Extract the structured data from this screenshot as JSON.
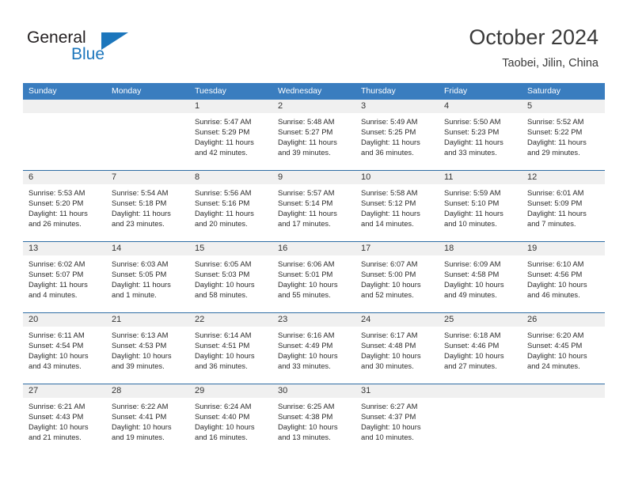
{
  "brand": {
    "name_part1": "General",
    "name_part2": "Blue",
    "accent_color": "#1c76bc"
  },
  "header": {
    "title": "October 2024",
    "location": "Taobei, Jilin, China"
  },
  "theme": {
    "header_bg": "#3a7dbf",
    "row_divider": "#2e6da4",
    "date_band_bg": "#f0f0f0"
  },
  "weekdays": [
    "Sunday",
    "Monday",
    "Tuesday",
    "Wednesday",
    "Thursday",
    "Friday",
    "Saturday"
  ],
  "weeks": [
    [
      {
        "date": "",
        "empty": true
      },
      {
        "date": "",
        "empty": true
      },
      {
        "date": "1",
        "sunrise": "Sunrise: 5:47 AM",
        "sunset": "Sunset: 5:29 PM",
        "daylight1": "Daylight: 11 hours",
        "daylight2": "and 42 minutes."
      },
      {
        "date": "2",
        "sunrise": "Sunrise: 5:48 AM",
        "sunset": "Sunset: 5:27 PM",
        "daylight1": "Daylight: 11 hours",
        "daylight2": "and 39 minutes."
      },
      {
        "date": "3",
        "sunrise": "Sunrise: 5:49 AM",
        "sunset": "Sunset: 5:25 PM",
        "daylight1": "Daylight: 11 hours",
        "daylight2": "and 36 minutes."
      },
      {
        "date": "4",
        "sunrise": "Sunrise: 5:50 AM",
        "sunset": "Sunset: 5:23 PM",
        "daylight1": "Daylight: 11 hours",
        "daylight2": "and 33 minutes."
      },
      {
        "date": "5",
        "sunrise": "Sunrise: 5:52 AM",
        "sunset": "Sunset: 5:22 PM",
        "daylight1": "Daylight: 11 hours",
        "daylight2": "and 29 minutes."
      }
    ],
    [
      {
        "date": "6",
        "sunrise": "Sunrise: 5:53 AM",
        "sunset": "Sunset: 5:20 PM",
        "daylight1": "Daylight: 11 hours",
        "daylight2": "and 26 minutes."
      },
      {
        "date": "7",
        "sunrise": "Sunrise: 5:54 AM",
        "sunset": "Sunset: 5:18 PM",
        "daylight1": "Daylight: 11 hours",
        "daylight2": "and 23 minutes."
      },
      {
        "date": "8",
        "sunrise": "Sunrise: 5:56 AM",
        "sunset": "Sunset: 5:16 PM",
        "daylight1": "Daylight: 11 hours",
        "daylight2": "and 20 minutes."
      },
      {
        "date": "9",
        "sunrise": "Sunrise: 5:57 AM",
        "sunset": "Sunset: 5:14 PM",
        "daylight1": "Daylight: 11 hours",
        "daylight2": "and 17 minutes."
      },
      {
        "date": "10",
        "sunrise": "Sunrise: 5:58 AM",
        "sunset": "Sunset: 5:12 PM",
        "daylight1": "Daylight: 11 hours",
        "daylight2": "and 14 minutes."
      },
      {
        "date": "11",
        "sunrise": "Sunrise: 5:59 AM",
        "sunset": "Sunset: 5:10 PM",
        "daylight1": "Daylight: 11 hours",
        "daylight2": "and 10 minutes."
      },
      {
        "date": "12",
        "sunrise": "Sunrise: 6:01 AM",
        "sunset": "Sunset: 5:09 PM",
        "daylight1": "Daylight: 11 hours",
        "daylight2": "and 7 minutes."
      }
    ],
    [
      {
        "date": "13",
        "sunrise": "Sunrise: 6:02 AM",
        "sunset": "Sunset: 5:07 PM",
        "daylight1": "Daylight: 11 hours",
        "daylight2": "and 4 minutes."
      },
      {
        "date": "14",
        "sunrise": "Sunrise: 6:03 AM",
        "sunset": "Sunset: 5:05 PM",
        "daylight1": "Daylight: 11 hours",
        "daylight2": "and 1 minute."
      },
      {
        "date": "15",
        "sunrise": "Sunrise: 6:05 AM",
        "sunset": "Sunset: 5:03 PM",
        "daylight1": "Daylight: 10 hours",
        "daylight2": "and 58 minutes."
      },
      {
        "date": "16",
        "sunrise": "Sunrise: 6:06 AM",
        "sunset": "Sunset: 5:01 PM",
        "daylight1": "Daylight: 10 hours",
        "daylight2": "and 55 minutes."
      },
      {
        "date": "17",
        "sunrise": "Sunrise: 6:07 AM",
        "sunset": "Sunset: 5:00 PM",
        "daylight1": "Daylight: 10 hours",
        "daylight2": "and 52 minutes."
      },
      {
        "date": "18",
        "sunrise": "Sunrise: 6:09 AM",
        "sunset": "Sunset: 4:58 PM",
        "daylight1": "Daylight: 10 hours",
        "daylight2": "and 49 minutes."
      },
      {
        "date": "19",
        "sunrise": "Sunrise: 6:10 AM",
        "sunset": "Sunset: 4:56 PM",
        "daylight1": "Daylight: 10 hours",
        "daylight2": "and 46 minutes."
      }
    ],
    [
      {
        "date": "20",
        "sunrise": "Sunrise: 6:11 AM",
        "sunset": "Sunset: 4:54 PM",
        "daylight1": "Daylight: 10 hours",
        "daylight2": "and 43 minutes."
      },
      {
        "date": "21",
        "sunrise": "Sunrise: 6:13 AM",
        "sunset": "Sunset: 4:53 PM",
        "daylight1": "Daylight: 10 hours",
        "daylight2": "and 39 minutes."
      },
      {
        "date": "22",
        "sunrise": "Sunrise: 6:14 AM",
        "sunset": "Sunset: 4:51 PM",
        "daylight1": "Daylight: 10 hours",
        "daylight2": "and 36 minutes."
      },
      {
        "date": "23",
        "sunrise": "Sunrise: 6:16 AM",
        "sunset": "Sunset: 4:49 PM",
        "daylight1": "Daylight: 10 hours",
        "daylight2": "and 33 minutes."
      },
      {
        "date": "24",
        "sunrise": "Sunrise: 6:17 AM",
        "sunset": "Sunset: 4:48 PM",
        "daylight1": "Daylight: 10 hours",
        "daylight2": "and 30 minutes."
      },
      {
        "date": "25",
        "sunrise": "Sunrise: 6:18 AM",
        "sunset": "Sunset: 4:46 PM",
        "daylight1": "Daylight: 10 hours",
        "daylight2": "and 27 minutes."
      },
      {
        "date": "26",
        "sunrise": "Sunrise: 6:20 AM",
        "sunset": "Sunset: 4:45 PM",
        "daylight1": "Daylight: 10 hours",
        "daylight2": "and 24 minutes."
      }
    ],
    [
      {
        "date": "27",
        "sunrise": "Sunrise: 6:21 AM",
        "sunset": "Sunset: 4:43 PM",
        "daylight1": "Daylight: 10 hours",
        "daylight2": "and 21 minutes."
      },
      {
        "date": "28",
        "sunrise": "Sunrise: 6:22 AM",
        "sunset": "Sunset: 4:41 PM",
        "daylight1": "Daylight: 10 hours",
        "daylight2": "and 19 minutes."
      },
      {
        "date": "29",
        "sunrise": "Sunrise: 6:24 AM",
        "sunset": "Sunset: 4:40 PM",
        "daylight1": "Daylight: 10 hours",
        "daylight2": "and 16 minutes."
      },
      {
        "date": "30",
        "sunrise": "Sunrise: 6:25 AM",
        "sunset": "Sunset: 4:38 PM",
        "daylight1": "Daylight: 10 hours",
        "daylight2": "and 13 minutes."
      },
      {
        "date": "31",
        "sunrise": "Sunrise: 6:27 AM",
        "sunset": "Sunset: 4:37 PM",
        "daylight1": "Daylight: 10 hours",
        "daylight2": "and 10 minutes."
      },
      {
        "date": "",
        "empty": true
      },
      {
        "date": "",
        "empty": true
      }
    ]
  ]
}
